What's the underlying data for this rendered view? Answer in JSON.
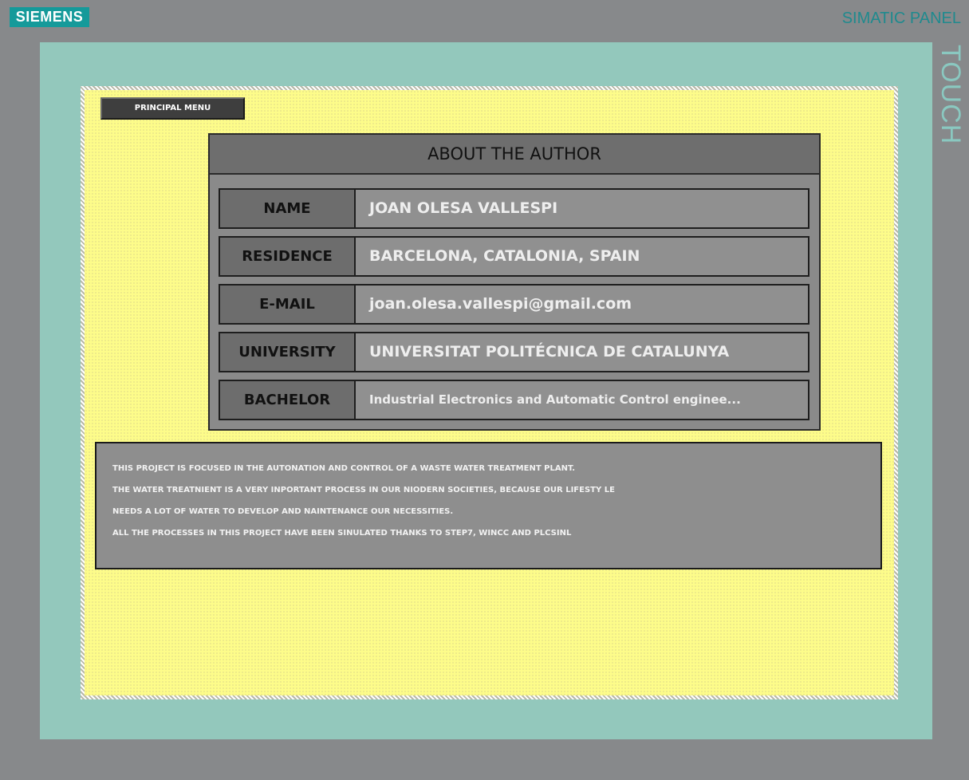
{
  "header": {
    "brand": "SIEMENS",
    "panel_title": "SIMATIC PANEL",
    "side_label": "TOUCH"
  },
  "screen": {
    "menu_button_label": "PRINCIPAL MENU",
    "card": {
      "title": "ABOUT THE AUTHOR",
      "rows": [
        {
          "label": "NAME",
          "value": "JOAN OLESA VALLESPI"
        },
        {
          "label": "RESIDENCE",
          "value": "BARCELONA, CATALONIA, SPAIN"
        },
        {
          "label": "E-MAIL",
          "value": "joan.olesa.vallespi@gmail.com"
        },
        {
          "label": "UNIVERSITY",
          "value": "UNIVERSITAT POLITÉCNICA DE CATALUNYA"
        },
        {
          "label": "BACHELOR",
          "value": "Industrial Electronics and Automatic Control enginee..."
        }
      ]
    },
    "description_lines": [
      "THIS PROJECT IS FOCUSED IN THE AUTONATION AND CONTROL OF A WASTE WATER TREATMENT PLANT.",
      "THE WATER TREATNIENT IS A VERY INPORTANT PROCESS IN OUR NIODERN SOCIETIES, BECAUSE OUR LIFESTY LE",
      "NEEDS A LOT OF WATER TO DEVELOP AND NAINTENANCE OUR NECESSITIES.",
      "ALL THE PROCESSES IN THIS PROJECT HAVE BEEN SINULATED THANKS TO STEP7, WINCC AND PLCSINL"
    ]
  },
  "colors": {
    "panel_gray": "#87898b",
    "bezel_teal": "#93c8bc",
    "screen_yellow": "#fdfc8a",
    "brand_teal": "#159a9a",
    "card_gray": "#8a8a8a"
  }
}
